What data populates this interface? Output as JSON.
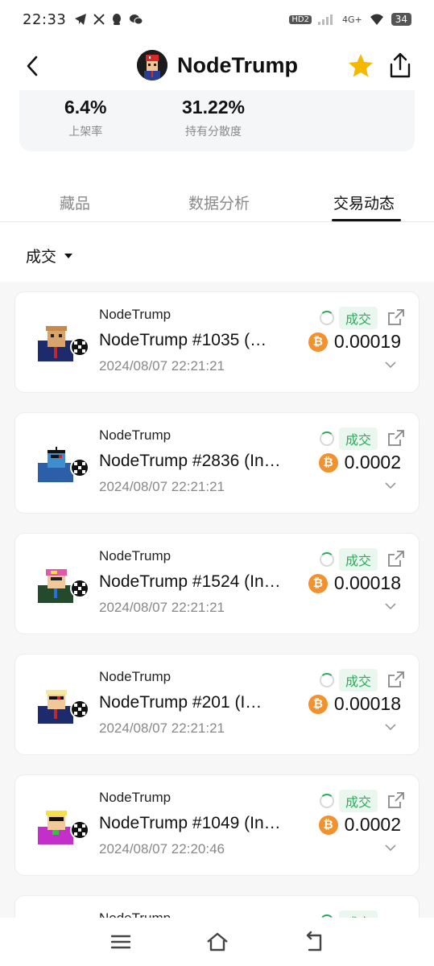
{
  "status_bar": {
    "time": "22:33",
    "network": "4G+",
    "hd": "HD2",
    "battery": "34"
  },
  "header": {
    "title": "NodeTrump"
  },
  "stats": [
    {
      "value": "6.4%",
      "label": "上架率"
    },
    {
      "value": "31.22%",
      "label": "持有分散度"
    }
  ],
  "tabs": [
    {
      "label": "藏品"
    },
    {
      "label": "数据分析"
    },
    {
      "label": "交易动态"
    }
  ],
  "filter": {
    "label": "成交"
  },
  "activities": [
    {
      "collection": "NodeTrump",
      "name": "NodeTrump #1035 (…",
      "time": "2024/08/07 22:21:21",
      "status": "成交",
      "price": "0.00019"
    },
    {
      "collection": "NodeTrump",
      "name": "NodeTrump #2836 (In…",
      "time": "2024/08/07 22:21:21",
      "status": "成交",
      "price": "0.0002"
    },
    {
      "collection": "NodeTrump",
      "name": "NodeTrump #1524 (In…",
      "time": "2024/08/07 22:21:21",
      "status": "成交",
      "price": "0.00018"
    },
    {
      "collection": "NodeTrump",
      "name": "NodeTrump #201 (I…",
      "time": "2024/08/07 22:21:21",
      "status": "成交",
      "price": "0.00018"
    },
    {
      "collection": "NodeTrump",
      "name": "NodeTrump #1049 (In…",
      "time": "2024/08/07 22:20:46",
      "status": "成交",
      "price": "0.0002"
    },
    {
      "collection": "NodeTrump",
      "name": "",
      "time": "",
      "status": "成交",
      "price": ""
    }
  ],
  "colors": {
    "accent_green": "#2eaa5c",
    "btc_orange": "#f2922e",
    "star_yellow": "#f5b800"
  },
  "icons": {
    "back": "back-arrow-icon",
    "star": "star-icon",
    "share": "share-icon",
    "btc": "bitcoin-icon",
    "external": "external-link-icon",
    "expand": "chevron-down-icon"
  }
}
